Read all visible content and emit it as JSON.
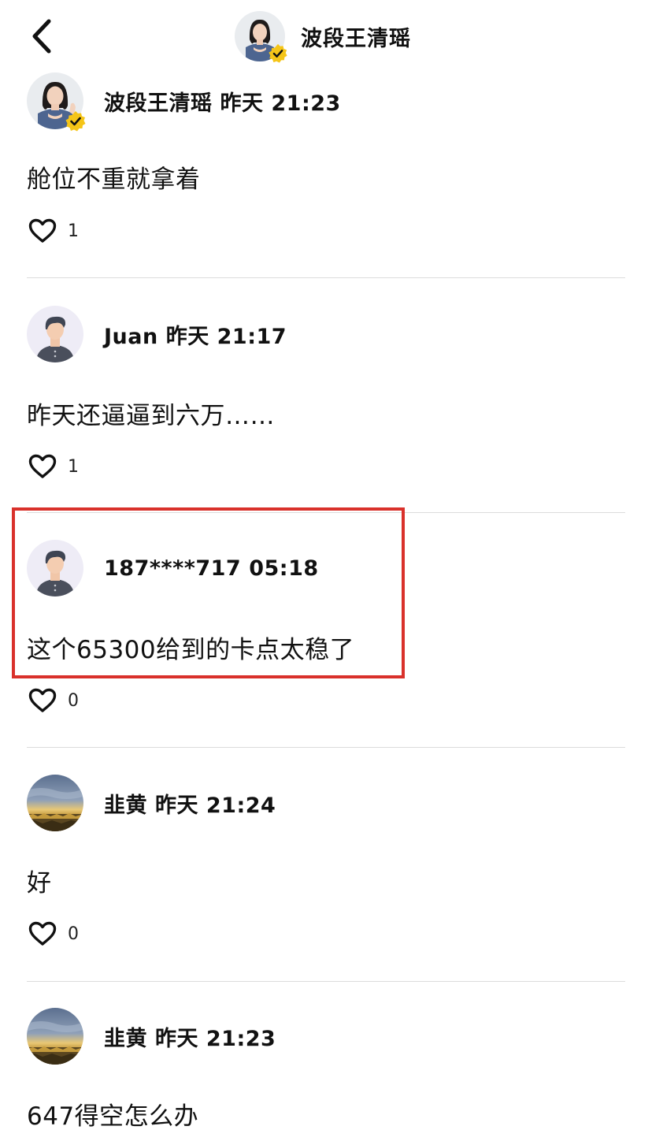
{
  "header": {
    "title": "波段王清瑶",
    "back_icon": "chevron-left-icon"
  },
  "colors": {
    "highlight": "#d9312b",
    "badge": "#f5c518",
    "divider": "#dcdcdc"
  },
  "comments": [
    {
      "username": "波段王清瑶",
      "time": "昨天 21:23",
      "text": "舱位不重就拿着",
      "likes": "1",
      "avatar": "woman-avatar",
      "verified": true
    },
    {
      "username": "Juan",
      "time": "昨天 21:17",
      "text": "昨天还逼逼到六万……",
      "likes": "1",
      "avatar": "default-person-avatar",
      "verified": false
    },
    {
      "username": "187****717",
      "time": "05:18",
      "text": "这个65300给到的卡点太稳了",
      "likes": "0",
      "avatar": "default-person-avatar",
      "verified": false,
      "highlighted": true
    },
    {
      "username": "韭黄",
      "time": "昨天 21:24",
      "text": "好",
      "likes": "0",
      "avatar": "landscape-avatar",
      "verified": false
    },
    {
      "username": "韭黄",
      "time": "昨天 21:23",
      "text": "647得空怎么办",
      "likes": "",
      "avatar": "landscape-avatar",
      "verified": false
    }
  ]
}
